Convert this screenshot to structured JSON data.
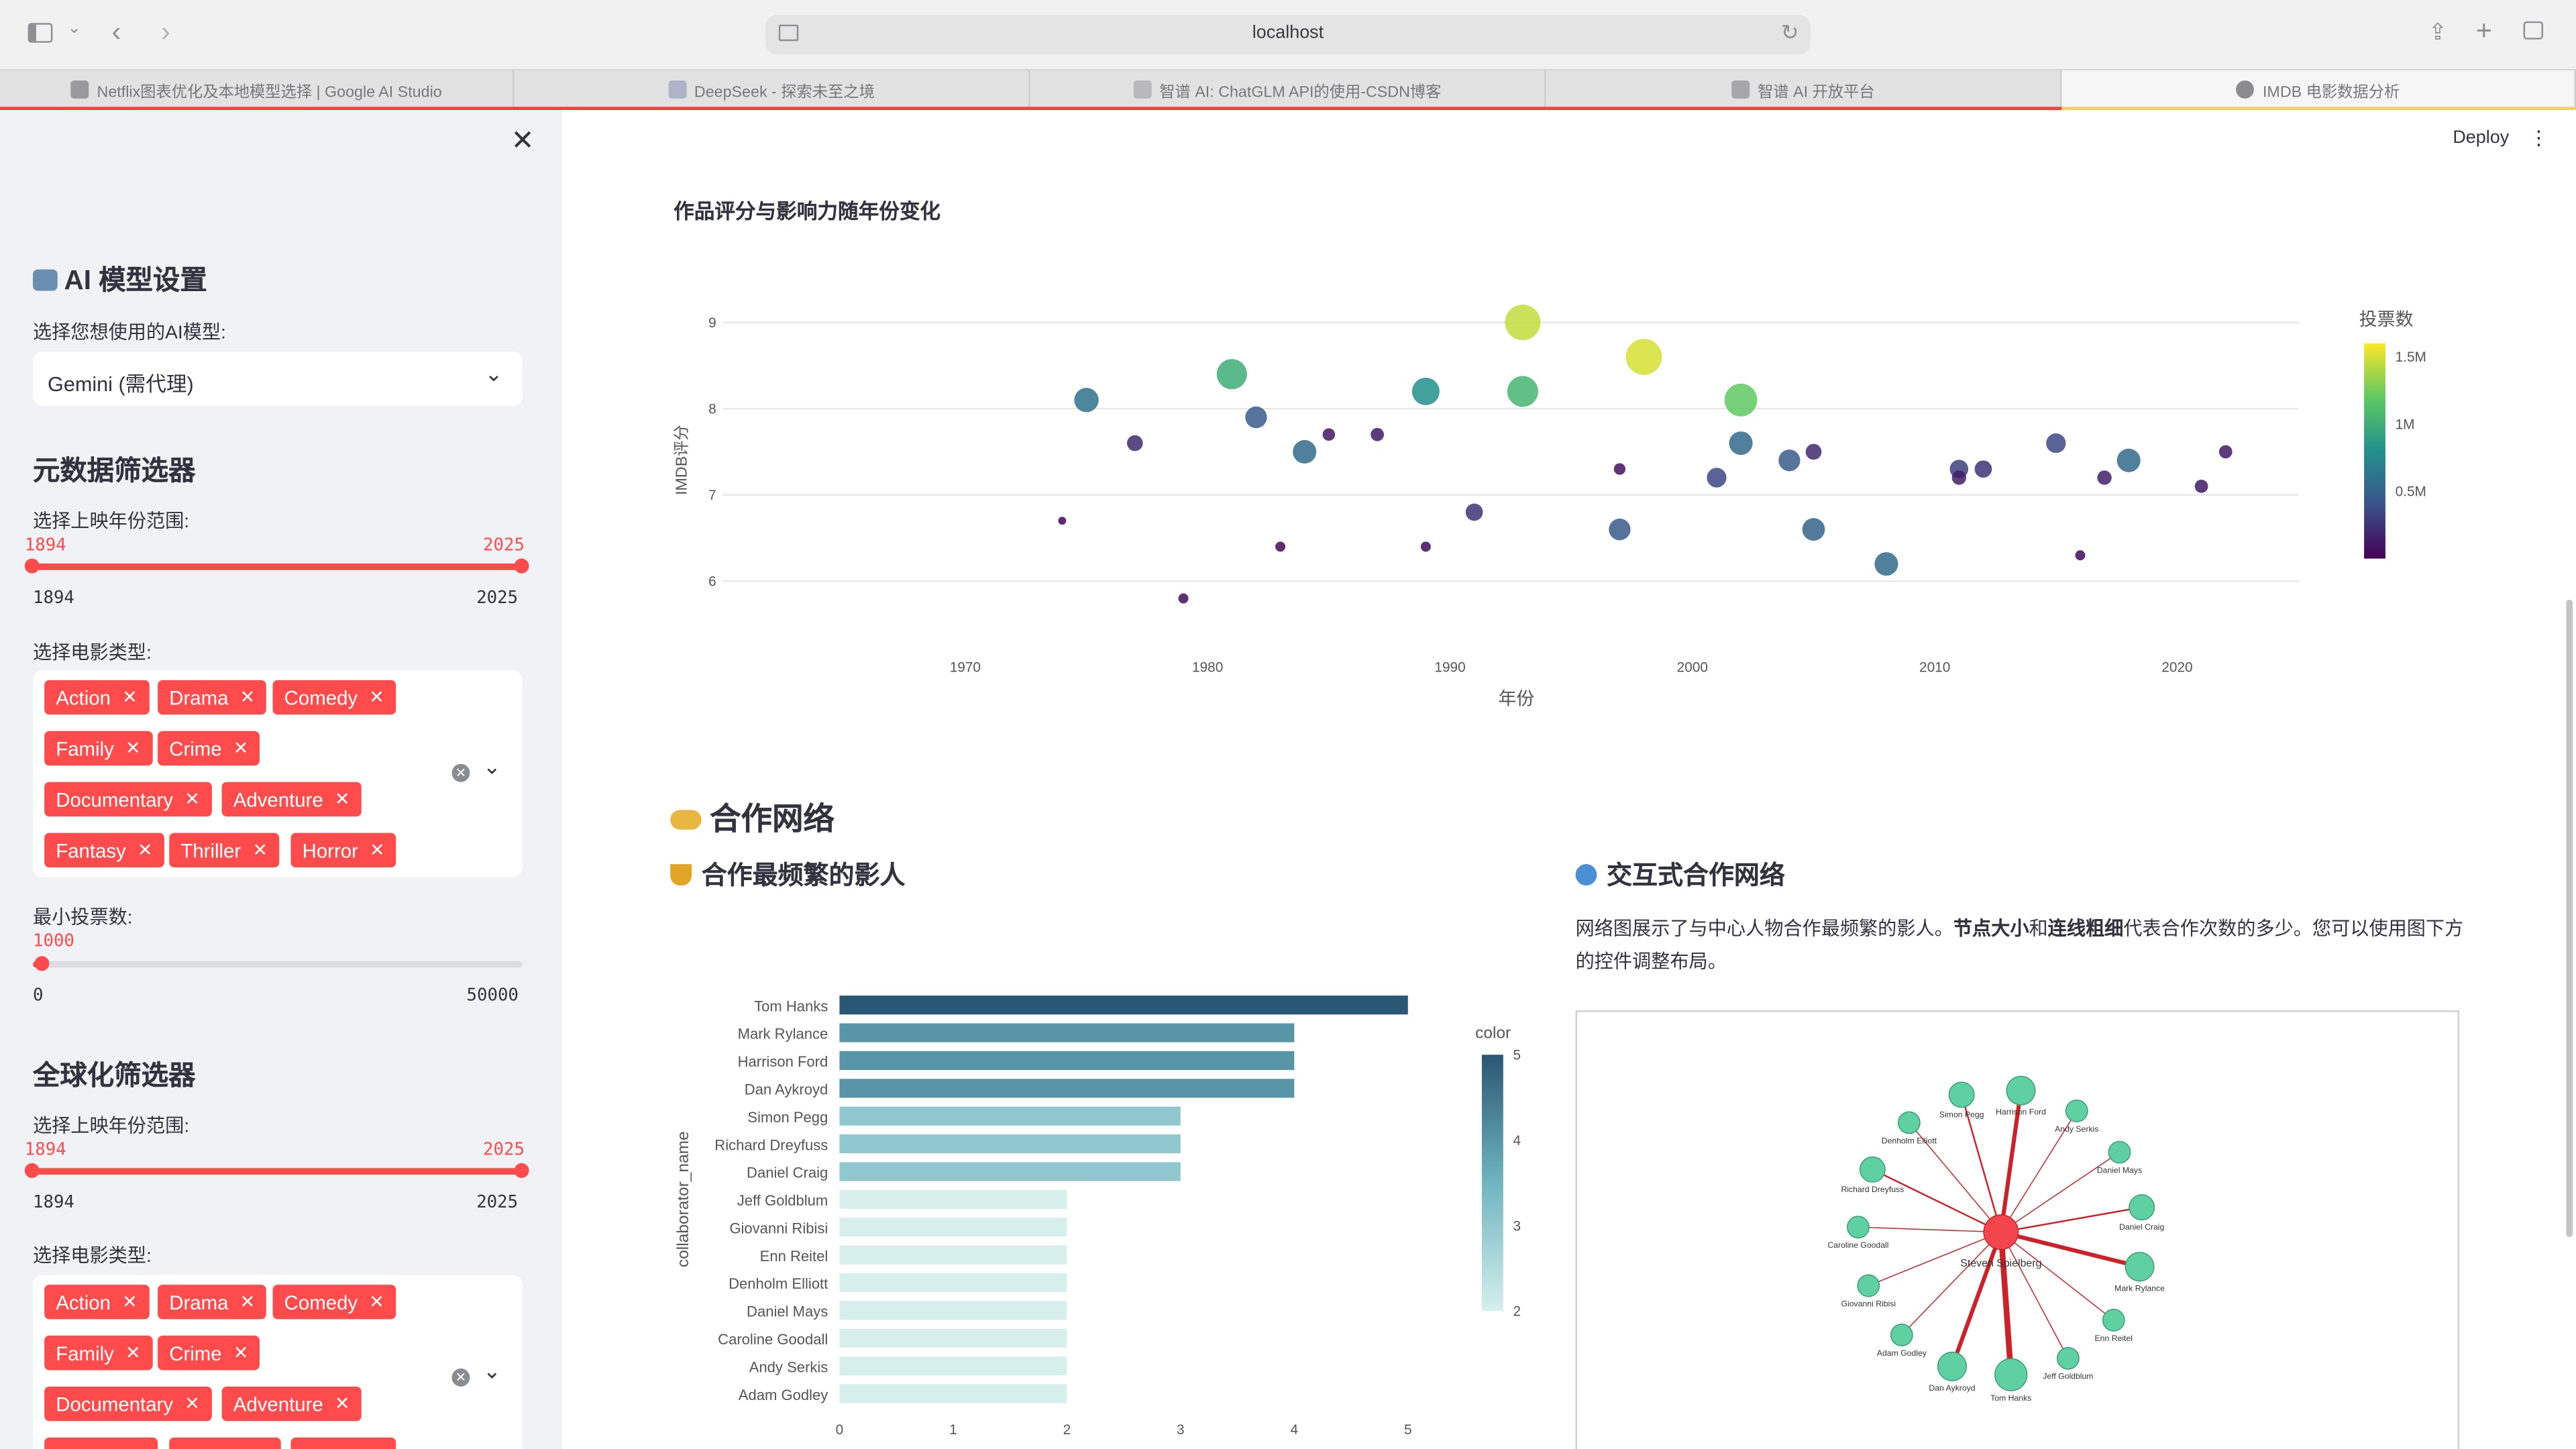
{
  "browser": {
    "url": "localhost",
    "tabs": [
      {
        "title": "Netflix图表优化及本地模型选择 | Google AI Studio",
        "active": false
      },
      {
        "title": "DeepSeek - 探索未至之境",
        "active": false
      },
      {
        "title": "智谱 AI: ChatGLM API的使用-CSDN博客",
        "active": false
      },
      {
        "title": "智谱 AI 开放平台",
        "active": false
      },
      {
        "title": "IMDB 电影数据分析",
        "active": true
      }
    ]
  },
  "header": {
    "deploy_label": "Deploy"
  },
  "sidebar": {
    "ai": {
      "heading": "AI 模型设置",
      "select_label": "选择您想使用的AI模型:",
      "selected_model": "Gemini (需代理)"
    },
    "meta_filter": {
      "heading": "元数据筛选器",
      "year_label": "选择上映年份范围:",
      "year_min": "1894",
      "year_max": "2025",
      "range_min": "1894",
      "range_max": "2025",
      "genre_label": "选择电影类型:",
      "genres": [
        "Action",
        "Drama",
        "Comedy",
        "Family",
        "Crime",
        "Documentary",
        "Adventure",
        "Fantasy",
        "Thriller",
        "Horror"
      ],
      "votes_label": "最小投票数:",
      "votes_value": "1000",
      "votes_min": "0",
      "votes_max": "50000"
    },
    "global_filter": {
      "heading": "全球化筛选器",
      "year_label": "选择上映年份范围:",
      "year_min": "1894",
      "year_max": "2025",
      "range_min": "1894",
      "range_max": "2025",
      "genre_label": "选择电影类型:",
      "genres": [
        "Action",
        "Drama",
        "Comedy",
        "Family",
        "Crime",
        "Documentary",
        "Adventure"
      ]
    }
  },
  "main": {
    "scatter_title": "作品评分与影响力随年份变化",
    "network_heading": "合作网络",
    "frequent_heading": "合作最频繁的影人",
    "interactive_heading": "交互式合作网络",
    "network_desc": {
      "p1": "网络图展示了与中心人物合作最频繁的影人。",
      "b1": "节点大小",
      "p2": "和",
      "b2": "连线粗细",
      "p3": "代表合作次数的多少。您可以使用图下方的控件调整布局。"
    }
  },
  "chart_data": [
    {
      "type": "scatter",
      "title": "作品评分与影响力随年份变化",
      "xlabel": "年份",
      "ylabel": "IMDB评分",
      "xlim": [
        1960,
        2025
      ],
      "ylim": [
        5.5,
        9.5
      ],
      "x_ticks": [
        1970,
        1980,
        1990,
        2000,
        2010,
        2020
      ],
      "y_ticks": [
        6,
        7,
        8,
        9
      ],
      "color_label": "投票数",
      "color_ticks": [
        "0.5M",
        "1M",
        "1.5M"
      ],
      "color_range": [
        0,
        1.6
      ],
      "colorscale": "viridis",
      "points": [
        {
          "x": 1974,
          "y": 6.7,
          "votes": 0.02
        },
        {
          "x": 1975,
          "y": 8.1,
          "votes": 0.6
        },
        {
          "x": 1977,
          "y": 7.6,
          "votes": 0.2
        },
        {
          "x": 1979,
          "y": 5.8,
          "votes": 0.05
        },
        {
          "x": 1981,
          "y": 8.4,
          "votes": 1.0
        },
        {
          "x": 1982,
          "y": 7.9,
          "votes": 0.45
        },
        {
          "x": 1983,
          "y": 6.4,
          "votes": 0.05
        },
        {
          "x": 1984,
          "y": 7.5,
          "votes": 0.55
        },
        {
          "x": 1985,
          "y": 7.7,
          "votes": 0.1
        },
        {
          "x": 1987,
          "y": 7.7,
          "votes": 0.12
        },
        {
          "x": 1989,
          "y": 6.4,
          "votes": 0.05
        },
        {
          "x": 1989,
          "y": 8.2,
          "votes": 0.8
        },
        {
          "x": 1991,
          "y": 6.8,
          "votes": 0.25
        },
        {
          "x": 1993,
          "y": 9.0,
          "votes": 1.45
        },
        {
          "x": 1993,
          "y": 8.2,
          "votes": 1.05
        },
        {
          "x": 1997,
          "y": 6.6,
          "votes": 0.45
        },
        {
          "x": 1997,
          "y": 7.3,
          "votes": 0.08
        },
        {
          "x": 1998,
          "y": 8.6,
          "votes": 1.5
        },
        {
          "x": 2001,
          "y": 7.2,
          "votes": 0.35
        },
        {
          "x": 2002,
          "y": 8.1,
          "votes": 1.2
        },
        {
          "x": 2002,
          "y": 7.6,
          "votes": 0.55
        },
        {
          "x": 2004,
          "y": 7.4,
          "votes": 0.45
        },
        {
          "x": 2005,
          "y": 7.5,
          "votes": 0.2
        },
        {
          "x": 2005,
          "y": 6.6,
          "votes": 0.5
        },
        {
          "x": 2008,
          "y": 6.2,
          "votes": 0.55
        },
        {
          "x": 2011,
          "y": 7.3,
          "votes": 0.3
        },
        {
          "x": 2011,
          "y": 7.2,
          "votes": 0.15
        },
        {
          "x": 2012,
          "y": 7.3,
          "votes": 0.25
        },
        {
          "x": 2015,
          "y": 7.6,
          "votes": 0.35
        },
        {
          "x": 2016,
          "y": 6.3,
          "votes": 0.05
        },
        {
          "x": 2017,
          "y": 7.2,
          "votes": 0.15
        },
        {
          "x": 2018,
          "y": 7.4,
          "votes": 0.55
        },
        {
          "x": 2021,
          "y": 7.1,
          "votes": 0.12
        },
        {
          "x": 2022,
          "y": 7.5,
          "votes": 0.12
        }
      ]
    },
    {
      "type": "bar",
      "orientation": "horizontal",
      "ylabel": "collaborator_name",
      "xlim": [
        0,
        5
      ],
      "x_ticks": [
        0,
        1,
        2,
        3,
        4,
        5
      ],
      "color_label": "color",
      "color_ticks": [
        2,
        3,
        4,
        5
      ],
      "color_range": [
        2,
        5
      ],
      "categories": [
        "Tom Hanks",
        "Mark Rylance",
        "Harrison Ford",
        "Dan Aykroyd",
        "Simon Pegg",
        "Richard Dreyfuss",
        "Daniel Craig",
        "Jeff Goldblum",
        "Giovanni Ribisi",
        "Enn Reitel",
        "Denholm Elliott",
        "Daniel Mays",
        "Caroline Goodall",
        "Andy Serkis",
        "Adam Godley"
      ],
      "values": [
        5,
        4,
        4,
        4,
        3,
        3,
        3,
        2,
        2,
        2,
        2,
        2,
        2,
        2,
        2
      ]
    },
    {
      "type": "network",
      "center": "Steven Spielberg",
      "nodes": [
        {
          "name": "Harrison Ford",
          "weight": 4
        },
        {
          "name": "Andy Serkis",
          "weight": 2
        },
        {
          "name": "Daniel Mays",
          "weight": 2
        },
        {
          "name": "Daniel Craig",
          "weight": 3
        },
        {
          "name": "Mark Rylance",
          "weight": 4
        },
        {
          "name": "Enn Reitel",
          "weight": 2
        },
        {
          "name": "Jeff Goldblum",
          "weight": 2
        },
        {
          "name": "Tom Hanks",
          "weight": 5
        },
        {
          "name": "Dan Aykroyd",
          "weight": 4
        },
        {
          "name": "Adam Godley",
          "weight": 2
        },
        {
          "name": "Giovanni Ribisi",
          "weight": 2
        },
        {
          "name": "Caroline Goodall",
          "weight": 2
        },
        {
          "name": "Richard Dreyfuss",
          "weight": 3
        },
        {
          "name": "Denholm Elliott",
          "weight": 2
        },
        {
          "name": "Simon Pegg",
          "weight": 3
        }
      ]
    }
  ]
}
